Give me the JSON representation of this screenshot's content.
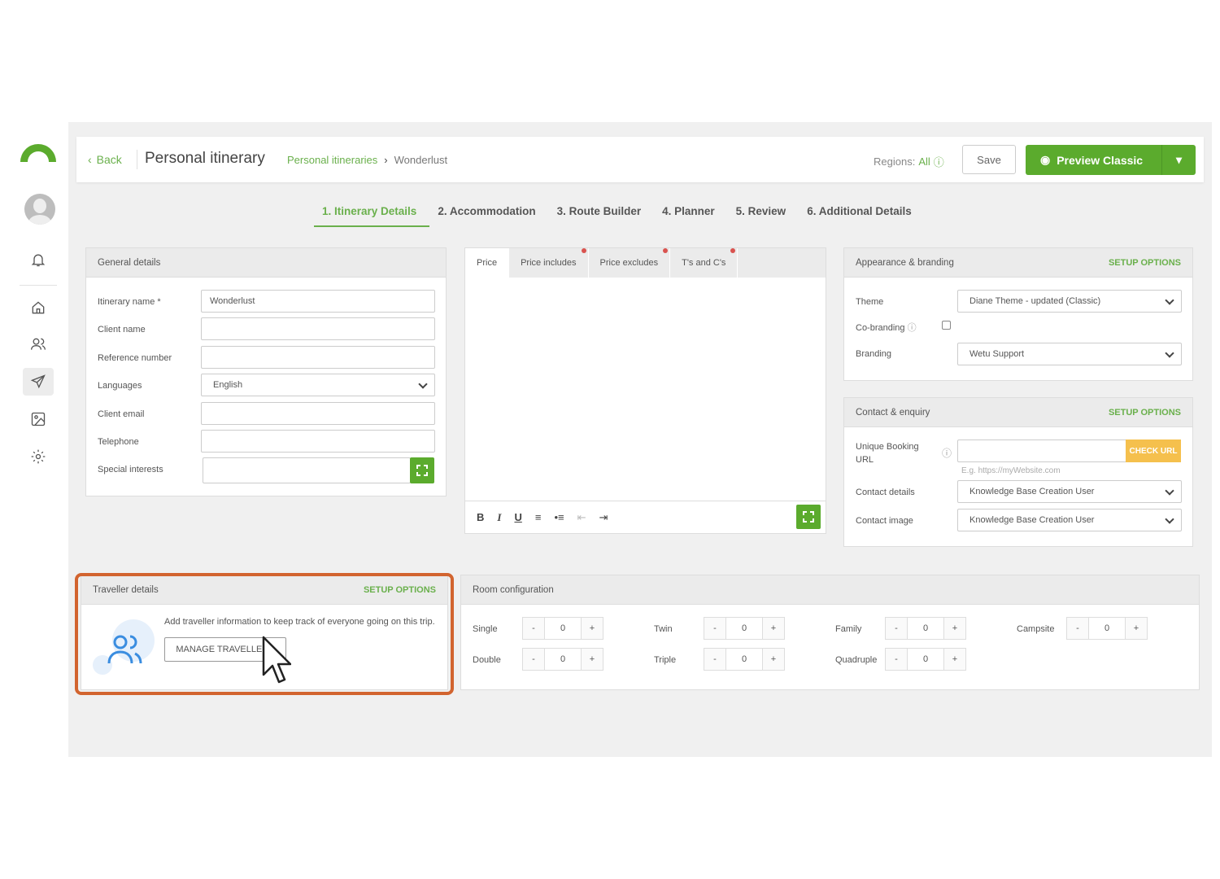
{
  "header": {
    "back": "Back",
    "title": "Personal itinerary",
    "crumb_parent": "Personal itineraries",
    "crumb_current": "Wonderlust",
    "regions_label": "Regions:",
    "regions_value": "All",
    "save": "Save",
    "preview": "Preview Classic"
  },
  "tabs": [
    "1. Itinerary Details",
    "2. Accommodation",
    "3. Route Builder",
    "4. Planner",
    "5. Review",
    "6. Additional Details"
  ],
  "general": {
    "title": "General details",
    "fields": [
      {
        "label": "Itinerary name *",
        "value": "Wonderlust"
      },
      {
        "label": "Client name",
        "value": ""
      },
      {
        "label": "Reference number",
        "value": ""
      },
      {
        "label": "Languages",
        "value": "English"
      },
      {
        "label": "Client email",
        "value": ""
      },
      {
        "label": "Telephone",
        "value": ""
      },
      {
        "label": "Special interests",
        "value": ""
      }
    ]
  },
  "editor": {
    "tabs": [
      "Price",
      "Price includes",
      "Price excludes",
      "T's and C's"
    ]
  },
  "appearance": {
    "title": "Appearance & branding",
    "setup": "SETUP OPTIONS",
    "theme_label": "Theme",
    "theme_value": "Diane Theme - updated (Classic)",
    "cobranding_label": "Co-branding",
    "branding_label": "Branding",
    "branding_value": "Wetu Support"
  },
  "contact": {
    "title": "Contact & enquiry",
    "setup": "SETUP OPTIONS",
    "booking_label_1": "Unique Booking",
    "booking_label_2": "URL",
    "booking_placeholder": "E.g. https://myWebsite.com",
    "check_url": "CHECK URL",
    "contact_details_label": "Contact details",
    "contact_details_value": "Knowledge Base Creation User",
    "contact_image_label": "Contact image",
    "contact_image_value": "Knowledge Base Creation User"
  },
  "traveller": {
    "title": "Traveller details",
    "setup": "SETUP OPTIONS",
    "text": "Add traveller information to keep track of everyone going on this trip.",
    "button": "MANAGE TRAVELLERS"
  },
  "rooms": {
    "title": "Room configuration",
    "minus": "-",
    "plus": "+",
    "items": [
      {
        "label": "Single",
        "value": "0"
      },
      {
        "label": "Twin",
        "value": "0"
      },
      {
        "label": "Family",
        "value": "0"
      },
      {
        "label": "Campsite",
        "value": "0"
      },
      {
        "label": "Double",
        "value": "0"
      },
      {
        "label": "Triple",
        "value": "0"
      },
      {
        "label": "Quadruple",
        "value": "0"
      }
    ]
  },
  "colors": {
    "accent": "#5bab2d",
    "highlight": "#d2642f",
    "warning": "#f5c04d"
  }
}
